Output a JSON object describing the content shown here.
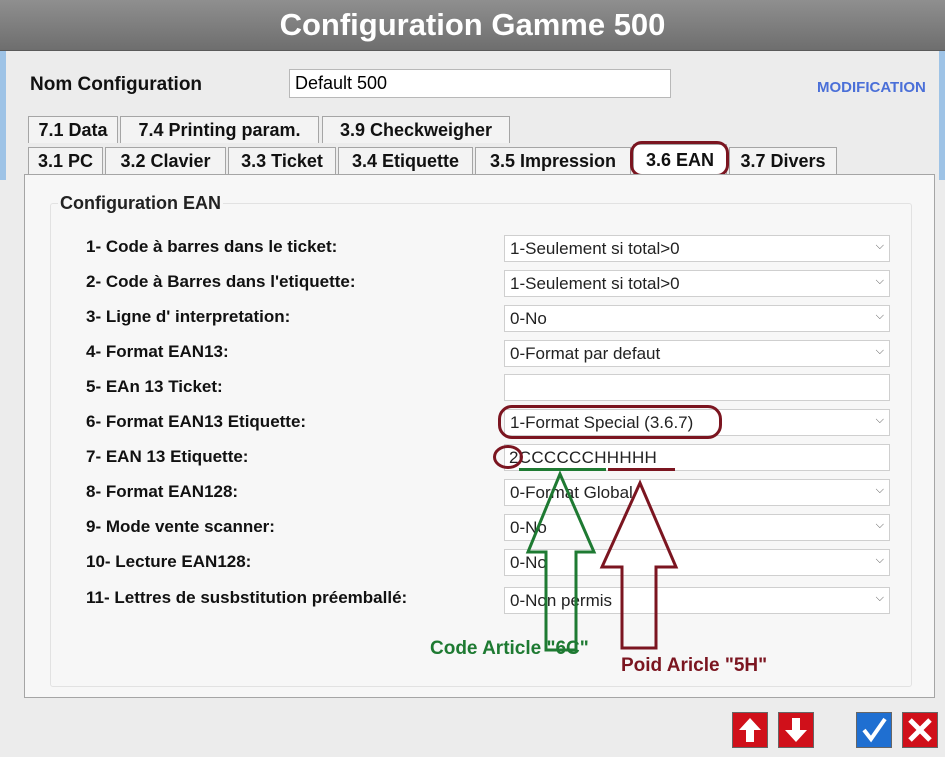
{
  "window": {
    "title": "Configuration Gamme 500"
  },
  "header": {
    "config_label": "Nom Configuration",
    "config_value": "Default 500",
    "modification_label": "MODIFICATION"
  },
  "tabs": {
    "row1": [
      {
        "label": "7.1 Data"
      },
      {
        "label": "7.4 Printing param."
      },
      {
        "label": "3.9 Checkweigher"
      }
    ],
    "row2": [
      {
        "label": "3.1 PC"
      },
      {
        "label": "3.2 Clavier"
      },
      {
        "label": "3.3 Ticket"
      },
      {
        "label": "3.4 Etiquette"
      },
      {
        "label": "3.5 Impression"
      },
      {
        "label": "3.6 EAN",
        "active": true
      },
      {
        "label": "3.7 Divers"
      }
    ]
  },
  "panel": {
    "title": "Configuration EAN",
    "rows": [
      {
        "label": "1- Code à barres dans le ticket:",
        "value": "1-Seulement si total>0",
        "type": "select"
      },
      {
        "label": "2- Code à Barres dans l'etiquette:",
        "value": "1-Seulement si total>0",
        "type": "select"
      },
      {
        "label": "3- Ligne d' interpretation:",
        "value": "0-No",
        "type": "select"
      },
      {
        "label": "4- Format EAN13:",
        "value": "0-Format par defaut",
        "type": "select"
      },
      {
        "label": "5- EAn 13 Ticket:",
        "value": "",
        "type": "text"
      },
      {
        "label": "6- Format EAN13 Etiquette:",
        "value": "1-Format Special (3.6.7)",
        "type": "select"
      },
      {
        "label": "7- EAN 13 Etiquette:",
        "value": "2CCCCCCHHHHH",
        "type": "text"
      },
      {
        "label": "8- Format EAN128:",
        "value": "0-Format Global",
        "type": "select"
      },
      {
        "label": "9- Mode vente scanner:",
        "value": "0-No",
        "type": "select"
      },
      {
        "label": "10- Lecture EAN128:",
        "value": "0-No",
        "type": "select"
      },
      {
        "label": "11- Lettres de susbstitution préemballé:",
        "value": "0-Non permis",
        "type": "select"
      }
    ]
  },
  "annotations": {
    "code_article": "Code Article \"6C\"",
    "poids_article": "Poid Aricle \"5H\"",
    "colors": {
      "green": "#1e7a32",
      "maroon": "#7b1520"
    }
  },
  "footer_buttons": [
    {
      "name": "up-arrow-icon"
    },
    {
      "name": "down-arrow-icon"
    },
    {
      "name": "check-icon"
    },
    {
      "name": "close-icon"
    }
  ]
}
